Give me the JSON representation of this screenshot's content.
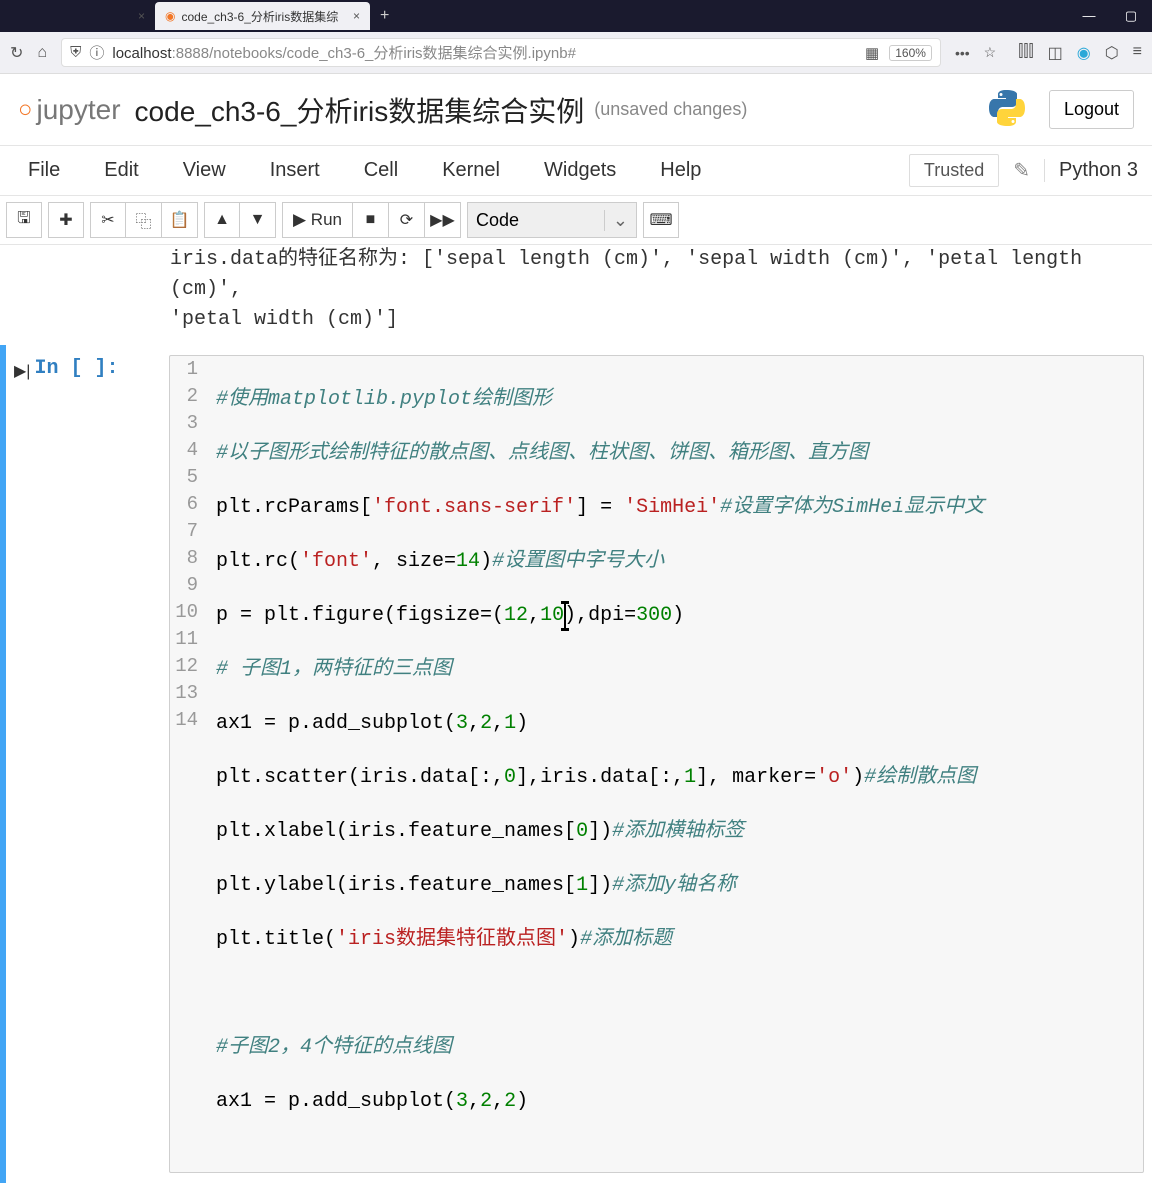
{
  "browser": {
    "tabs": {
      "blank_close": "×",
      "active_title": "code_ch3-6_分析iris数据集综",
      "active_close": "×",
      "add": "+"
    },
    "window": {
      "min": "—",
      "max": "▢"
    }
  },
  "urlbar": {
    "shield": "⛨",
    "info": "ⓘ",
    "host": "localhost",
    "port": ":8888",
    "path": "/notebooks/code_ch3-6_分析iris数据集综合实例.ipynb#",
    "zoom": "160%",
    "dots": "•••",
    "star": "☆"
  },
  "jupyter": {
    "logo_text": "jupyter",
    "title": "code_ch3-6_分析iris数据集综合实例",
    "status": "(unsaved changes)",
    "logout": "Logout"
  },
  "menu": {
    "file": "File",
    "edit": "Edit",
    "view": "View",
    "insert": "Insert",
    "cell": "Cell",
    "kernel": "Kernel",
    "widgets": "Widgets",
    "help": "Help",
    "trusted": "Trusted",
    "kernel_name": "Python 3"
  },
  "toolbar": {
    "save": "🖫",
    "add": "✚",
    "cut": "✂",
    "copy": "⿻",
    "paste": "📋",
    "up": "▲",
    "down": "▼",
    "run": "▶ Run",
    "stop": "■",
    "restart": "⟳",
    "ff": "▶▶",
    "cell_type": "Code",
    "cmd": "⌨"
  },
  "output": {
    "l1": "iris.data的特征名称为:  ['sepal length (cm)', 'sepal width (cm)', 'petal length (cm)',",
    "l2": "'petal width (cm)']"
  },
  "cell": {
    "prompt": "In  [  ]:",
    "gutter": [
      "1",
      "2",
      "3",
      "4",
      "5",
      "6",
      "7",
      "8",
      "9",
      "10",
      "11",
      "12",
      "13",
      "14"
    ],
    "code": {
      "l1_c": "#使用matplotlib.pyplot绘制图形",
      "l2_c": "#以子图形式绘制特征的散点图、点线图、柱状图、饼图、箱形图、直方图",
      "l3a": "plt.rcParams[",
      "l3s1": "'font.sans-serif'",
      "l3b": "] =",
      "l3s2": "'SimHei'",
      "l3c": "#设置字体为SimHei显示中文",
      "l4a": "plt.rc(",
      "l4s": "'font'",
      "l4b": ", size=",
      "l4n": "14",
      "l4c": ")",
      "l4cm": "#设置图中字号大小",
      "l5a": "p = plt.figure(figsize=(",
      "l5n1": "12",
      "l5b": ",",
      "l5n2": "10",
      "l5c": "),dpi=",
      "l5n3": "300",
      "l5d": ")",
      "l6_c": "# 子图1，两特征的三点图",
      "l7a": "ax1 = p.add_subplot(",
      "l7n": "3",
      "l7b": ",",
      "l7n2": "2",
      "l7c": ",",
      "l7n3": "1",
      "l7d": ")",
      "l8a": "plt.scatter(iris.data[:,",
      "l8n1": "0",
      "l8b": "],iris.data[:,",
      "l8n2": "1",
      "l8c": "], marker=",
      "l8s": "'o'",
      "l8d": ")",
      "l8cm": "#绘制散点图",
      "l9a": "plt.xlabel(iris.feature_names[",
      "l9n": "0",
      "l9b": "])",
      "l9cm": "#添加横轴标签",
      "l10a": "plt.ylabel(iris.feature_names[",
      "l10n": "1",
      "l10b": "])",
      "l10cm": "#添加y轴名称",
      "l11a": "plt.title(",
      "l11s": "'iris数据集特征散点图'",
      "l11b": ")",
      "l11cm": "#添加标题",
      "l12": "",
      "l13_c": "#子图2，4个特征的点线图",
      "l14a": "ax1 = p.add_subplot(",
      "l14n1": "3",
      "l14b": ",",
      "l14n2": "2",
      "l14c": ",",
      "l14n3": "2",
      "l14d": ")"
    }
  }
}
